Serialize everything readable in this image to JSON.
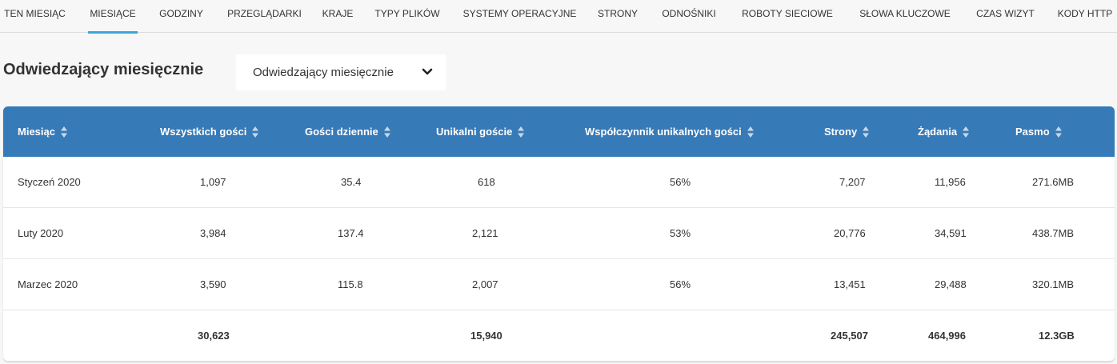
{
  "tabs": [
    {
      "label": "TEN MIESIĄC"
    },
    {
      "label": "MIESIĄCE"
    },
    {
      "label": "GODZINY"
    },
    {
      "label": "PRZEGLĄDARKI"
    },
    {
      "label": "KRAJE"
    },
    {
      "label": "TYPY PLIKÓW"
    },
    {
      "label": "SYSTEMY OPERACYJNE"
    },
    {
      "label": "STRONY"
    },
    {
      "label": "ODNOŚNIKI"
    },
    {
      "label": "ROBOTY SIECIOWE"
    },
    {
      "label": "SŁOWA KLUCZOWE"
    },
    {
      "label": "CZAS WIZYT"
    },
    {
      "label": "KODY HTTP"
    }
  ],
  "active_tab": "MIESIĄCE",
  "section": {
    "title": "Odwiedzający miesięcznie",
    "select_value": "Odwiedzający miesięcznie"
  },
  "table": {
    "headers": [
      "Miesiąc",
      "Wszystkich gości",
      "Gości dziennie",
      "Unikalni goście",
      "Współczynnik unikalnych gości",
      "Strony",
      "Żądania",
      "Pasmo"
    ],
    "rows": [
      [
        "Styczeń 2020",
        "1,097",
        "35.4",
        "618",
        "56%",
        "7,207",
        "11,956",
        "271.6MB"
      ],
      [
        "Luty 2020",
        "3,984",
        "137.4",
        "2,121",
        "53%",
        "20,776",
        "34,591",
        "438.7MB"
      ],
      [
        "Marzec 2020",
        "3,590",
        "115.8",
        "2,007",
        "56%",
        "13,451",
        "29,488",
        "320.1MB"
      ]
    ],
    "totals": [
      "",
      "30,623",
      "",
      "15,940",
      "",
      "245,507",
      "464,996",
      "12.3GB"
    ]
  },
  "colors": {
    "header_bg": "#367ab8",
    "active_tab_underline": "#3ba6d6"
  }
}
